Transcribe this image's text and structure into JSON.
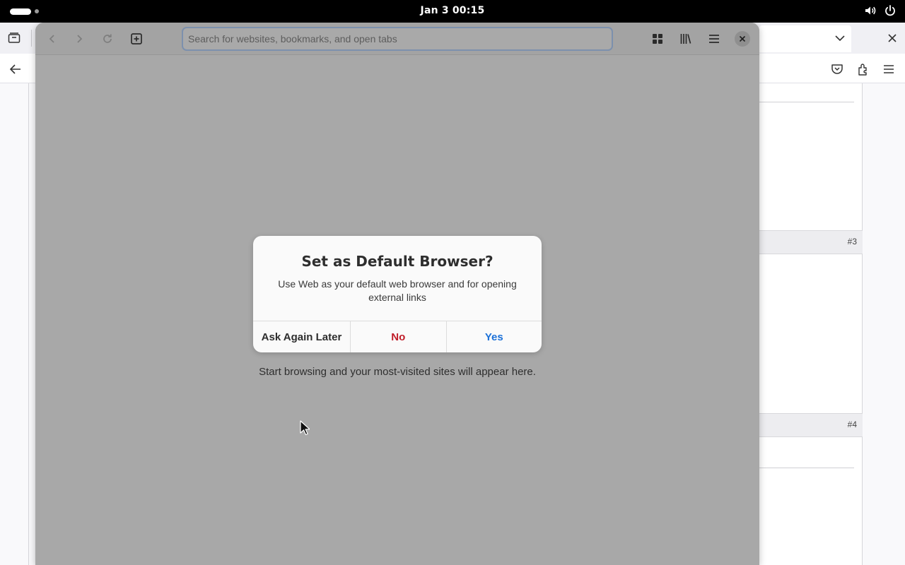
{
  "topbar": {
    "clock": "Jan 3  00:15",
    "icons": [
      "activities-indicator",
      "volume-icon",
      "power-icon"
    ]
  },
  "firefox": {
    "icons": [
      "tab-overview-icon",
      "list-all-tabs-icon",
      "close-icon",
      "back-arrow-icon",
      "pocket-icon",
      "extensions-icon",
      "hamburger-menu-icon"
    ],
    "rows": [
      {
        "label": "#3"
      },
      {
        "label": "#4"
      }
    ]
  },
  "web": {
    "search": {
      "placeholder": "Search for websites, bookmarks, and open tabs",
      "value": ""
    },
    "toolbar_icons": [
      "back-icon",
      "forward-icon",
      "reload-icon",
      "new-tab-icon",
      "tab-overview-icon",
      "library-icon",
      "menu-icon",
      "close-icon"
    ],
    "empty_message": "Start browsing and your most-visited sites will appear here."
  },
  "dialog": {
    "title": "Set as Default Browser?",
    "body": "Use Web as your default web browser and for opening external links",
    "buttons": {
      "later": "Ask Again Later",
      "no": "No",
      "yes": "Yes"
    },
    "colors": {
      "destructive": "#c01c28",
      "suggested": "#1c71d8"
    }
  }
}
